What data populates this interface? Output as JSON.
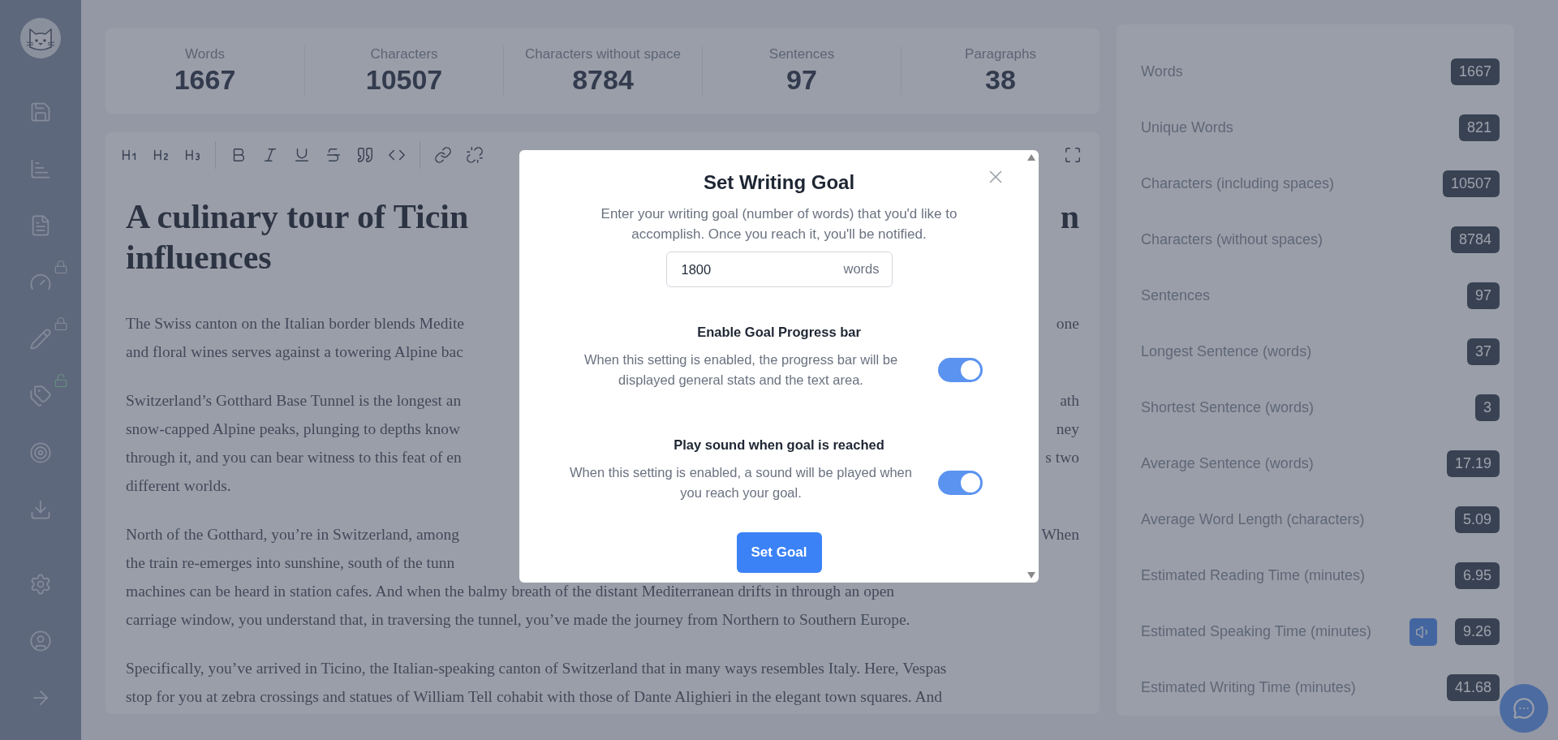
{
  "sidebar": {
    "items": [
      {
        "kind": "save"
      },
      {
        "kind": "stats"
      },
      {
        "kind": "document"
      },
      {
        "kind": "gauge",
        "locked": true
      },
      {
        "kind": "pencil",
        "locked": true
      },
      {
        "kind": "tags",
        "locked": false
      },
      {
        "kind": "target"
      },
      {
        "kind": "download"
      }
    ],
    "bottom_items": [
      {
        "kind": "settings"
      },
      {
        "kind": "user"
      },
      {
        "kind": "arrow"
      }
    ]
  },
  "summary": [
    {
      "label": "Words",
      "value": "1667"
    },
    {
      "label": "Characters",
      "value": "10507"
    },
    {
      "label": "Characters without space",
      "value": "8784"
    },
    {
      "label": "Sentences",
      "value": "97"
    },
    {
      "label": "Paragraphs",
      "value": "38"
    }
  ],
  "toolbar": {
    "left": [
      {
        "kind": "h1"
      },
      {
        "kind": "h2"
      },
      {
        "kind": "h3"
      },
      {
        "kind": "sep"
      },
      {
        "kind": "bold"
      },
      {
        "kind": "italic"
      },
      {
        "kind": "underline"
      },
      {
        "kind": "strike"
      },
      {
        "kind": "quote"
      },
      {
        "kind": "code"
      },
      {
        "kind": "sep"
      },
      {
        "kind": "link"
      },
      {
        "kind": "unlink"
      }
    ],
    "right": [
      {
        "kind": "fullscreen"
      }
    ]
  },
  "document": {
    "title_lines": [
      {
        "left": "A culinary tour of Ticin",
        "right": "n"
      },
      {
        "left": "influences"
      }
    ],
    "paragraphs": [
      [
        {
          "left": "The Swiss canton on the Italian border blends Medite",
          "right": "one"
        },
        {
          "left": "and floral wines serves against a towering Alpine bac"
        }
      ],
      [
        {
          "left": "Switzerland’s Gotthard Base Tunnel is the longest an",
          "right": "ath"
        },
        {
          "left": "snow-capped Alpine peaks, plunging to depths know",
          "right": "ney"
        },
        {
          "left": "through it, and you can bear witness to this feat of en",
          "right": "s two"
        },
        {
          "left": "different worlds."
        }
      ],
      [
        {
          "left": "North of the Gotthard, you’re in Switzerland, among",
          "right": "When"
        },
        {
          "left": "the train re-emerges into sunshine, south of the tunn"
        },
        {
          "left": "machines can be heard in station cafes. And when the balmy breath of the distant Mediterranean drifts in through an open"
        },
        {
          "left": "carriage window, you understand that, in traversing the tunnel, you’ve made the journey from Northern to Southern Europe."
        }
      ],
      [
        {
          "left": "Specifically, you’ve arrived in Ticino, the Italian-speaking canton of Switzerland that in many ways resembles Italy. Here, Vespas"
        },
        {
          "left": "stop for you at zebra crossings and statues of William Tell cohabit with those of Dante Alighieri in the elegant town squares. And"
        }
      ]
    ]
  },
  "stats_panel": [
    {
      "label": "Words",
      "value": "1667"
    },
    {
      "label": "Unique Words",
      "value": "821"
    },
    {
      "label": "Characters (including spaces)",
      "value": "10507"
    },
    {
      "label": "Characters (without spaces)",
      "value": "8784"
    },
    {
      "label": "Sentences",
      "value": "97"
    },
    {
      "label": "Longest Sentence (words)",
      "value": "37"
    },
    {
      "label": "Shortest Sentence (words)",
      "value": "3"
    },
    {
      "label": "Average Sentence (words)",
      "value": "17.19"
    },
    {
      "label": "Average Word Length (characters)",
      "value": "5.09"
    },
    {
      "label": "Estimated Reading Time (minutes)",
      "value": "6.95"
    },
    {
      "label": "Estimated Speaking Time (minutes)",
      "value": "9.26",
      "speak_button": true
    },
    {
      "label": "Estimated Writing Time (minutes)",
      "value": "41.68"
    }
  ],
  "modal": {
    "title": "Set Writing Goal",
    "description": "Enter your writing goal (number of words) that you'd like to accomplish. Once you reach it, you'll be notified.",
    "goal_value": "1800",
    "goal_unit": "words",
    "settings": [
      {
        "title": "Enable Goal Progress bar",
        "description": "When this setting is enabled, the progress bar will be displayed general stats and the text area.",
        "on": true
      },
      {
        "title": "Play sound when goal is reached",
        "description": "When this setting is enabled, a sound will be played when you reach your goal.",
        "on": true
      }
    ],
    "button": "Set Goal"
  }
}
